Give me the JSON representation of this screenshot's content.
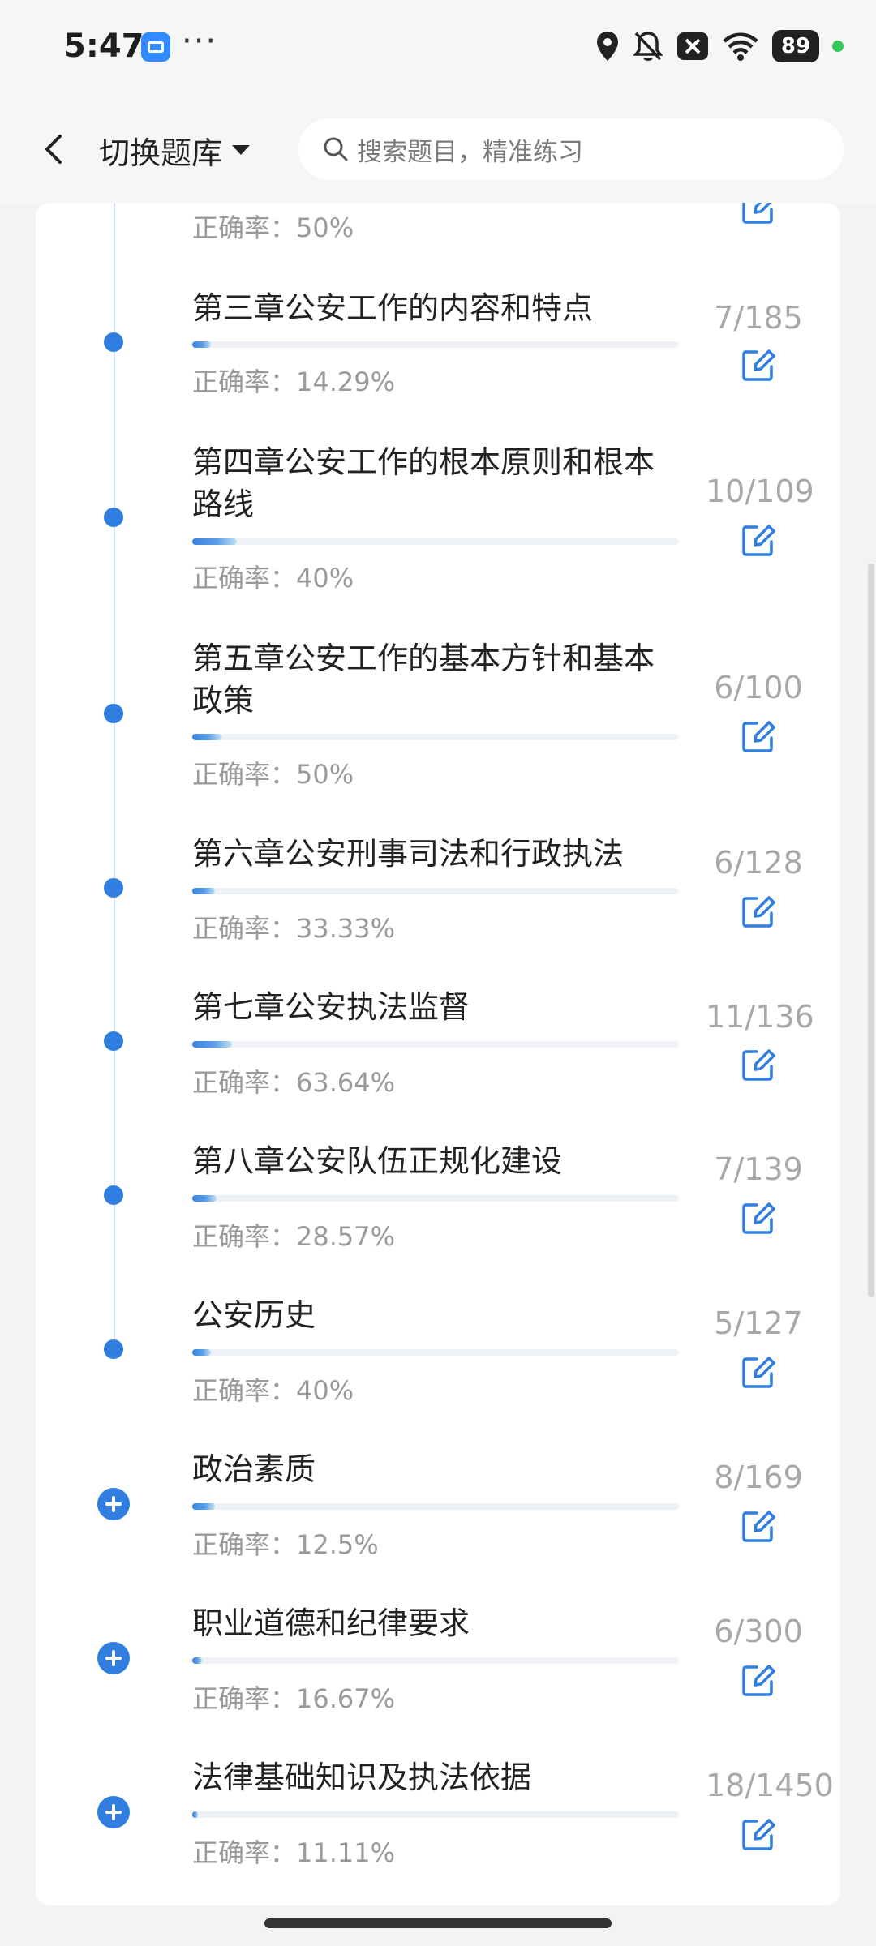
{
  "status_bar": {
    "time": "5:47",
    "more": "···",
    "battery": "89"
  },
  "header": {
    "bank_switch_label": "切换题库",
    "search_placeholder": "搜索题目，精准练习"
  },
  "rows": [
    {
      "title": "",
      "accuracy": "正确率：50%",
      "count": "",
      "progress": 0.0,
      "marker": "none"
    },
    {
      "title": "第三章公安工作的内容和特点",
      "accuracy": "正确率：14.29%",
      "count": "7/185",
      "progress": 0.038,
      "marker": "dot"
    },
    {
      "title": "第四章公安工作的根本原则和根本路线",
      "accuracy": "正确率：40%",
      "count": "10/109",
      "progress": 0.092,
      "marker": "dot"
    },
    {
      "title": "第五章公安工作的基本方针和基本政策",
      "accuracy": "正确率：50%",
      "count": "6/100",
      "progress": 0.06,
      "marker": "dot"
    },
    {
      "title": "第六章公安刑事司法和行政执法",
      "accuracy": "正确率：33.33%",
      "count": "6/128",
      "progress": 0.047,
      "marker": "dot"
    },
    {
      "title": "第七章公安执法监督",
      "accuracy": "正确率：63.64%",
      "count": "11/136",
      "progress": 0.081,
      "marker": "dot"
    },
    {
      "title": "第八章公安队伍正规化建设",
      "accuracy": "正确率：28.57%",
      "count": "7/139",
      "progress": 0.05,
      "marker": "dot"
    },
    {
      "title": "公安历史",
      "accuracy": "正确率：40%",
      "count": "5/127",
      "progress": 0.039,
      "marker": "dot"
    },
    {
      "title": "政治素质",
      "accuracy": "正确率：12.5%",
      "count": "8/169",
      "progress": 0.047,
      "marker": "plus"
    },
    {
      "title": "职业道德和纪律要求",
      "accuracy": "正确率：16.67%",
      "count": "6/300",
      "progress": 0.02,
      "marker": "plus"
    },
    {
      "title": "法律基础知识及执法依据",
      "accuracy": "正确率：11.11%",
      "count": "18/1450",
      "progress": 0.012,
      "marker": "plus"
    }
  ]
}
